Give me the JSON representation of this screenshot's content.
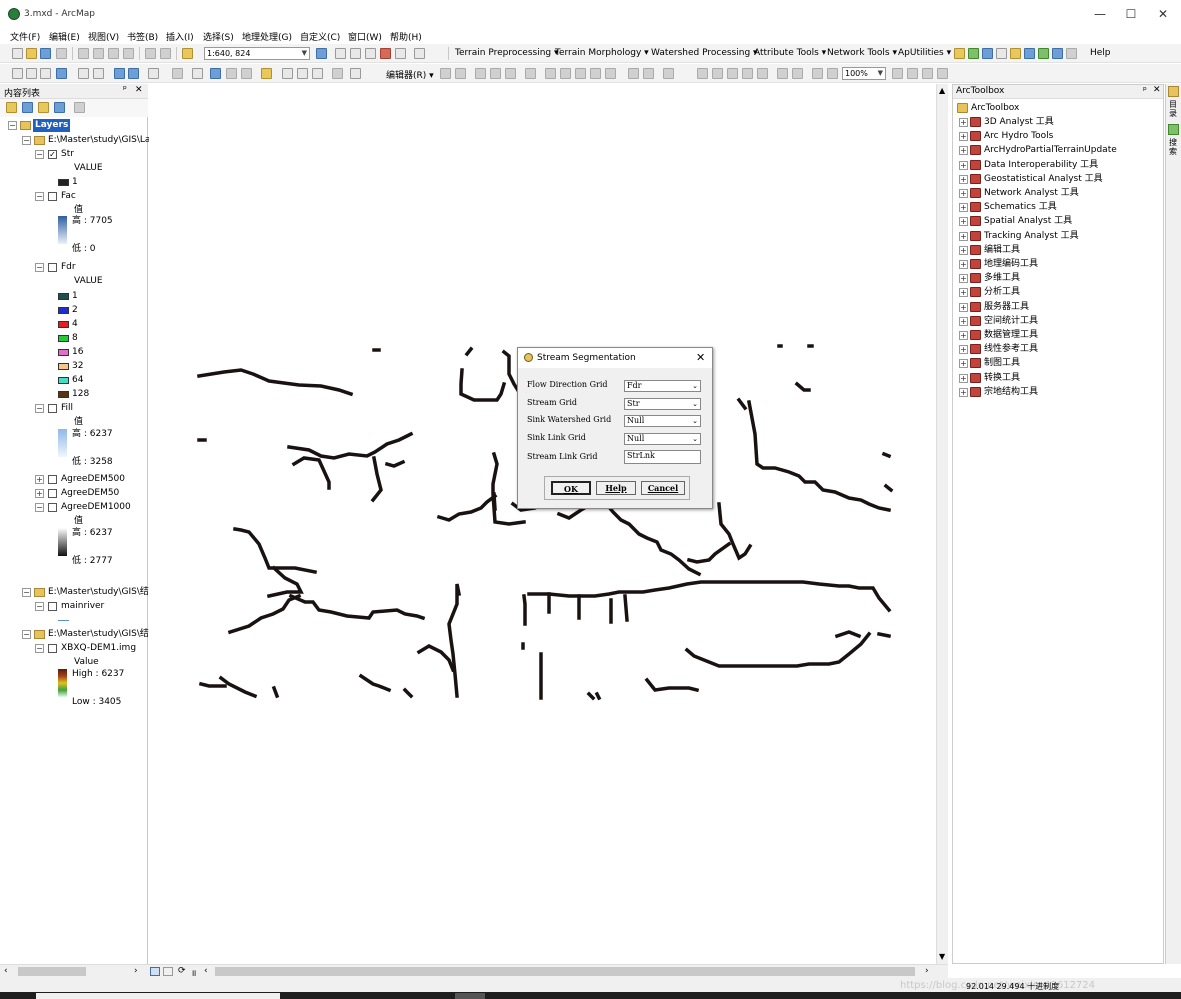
{
  "window": {
    "title": "3.mxd - ArcMap",
    "minimize": "—",
    "maximize": "☐",
    "close": "✕"
  },
  "menu": [
    "文件(F)",
    "编辑(E)",
    "视图(V)",
    "书签(B)",
    "插入(I)",
    "选择(S)",
    "地理处理(G)",
    "自定义(C)",
    "窗口(W)",
    "帮助(H)"
  ],
  "toolbar1": {
    "scale": "1:640, 824",
    "terrain_preprocessing": "Terrain Preprocessing ▾",
    "terrain_morphology": "Terrain Morphology ▾",
    "watershed_processing": "Watershed Processing ▾",
    "attribute_tools": "Attribute Tools ▾",
    "network_tools": "Network Tools ▾",
    "aputilities": "ApUtilities ▾",
    "help": "Help"
  },
  "toolbar2": {
    "editor": "编辑器(R) ▾",
    "zoom": "100%"
  },
  "toc": {
    "title": "内容列表",
    "pin": "ᵖ",
    "close": "✕",
    "layers_label": "Layers",
    "group1_label": "E:\\Master\\study\\GIS\\La",
    "group2_label": "E:\\Master\\study\\GIS\\结",
    "group3_label": "E:\\Master\\study\\GIS\\结",
    "str": {
      "name": "Str",
      "field": "VALUE",
      "value": "1"
    },
    "fac": {
      "name": "Fac",
      "field": "值",
      "high": "高 : 7705",
      "low": "低 : 0"
    },
    "fdr": {
      "name": "Fdr",
      "field": "VALUE",
      "classes": [
        {
          "label": "1",
          "color": "#1f4e4e"
        },
        {
          "label": "2",
          "color": "#1b2fd1"
        },
        {
          "label": "4",
          "color": "#e51f1f"
        },
        {
          "label": "8",
          "color": "#24c93a"
        },
        {
          "label": "16",
          "color": "#e76cc9"
        },
        {
          "label": "32",
          "color": "#f2c98a"
        },
        {
          "label": "64",
          "color": "#3fe0c3"
        },
        {
          "label": "128",
          "color": "#5a3512"
        }
      ]
    },
    "fill": {
      "name": "Fill",
      "field": "值",
      "high": "高 : 6237",
      "low": "低 : 3258"
    },
    "agreedem500": "AgreeDEM500",
    "agreedem50": "AgreeDEM50",
    "agreedem1000": {
      "name": "AgreeDEM1000",
      "field": "值",
      "high": "高 : 6237",
      "low": "低 : 2777"
    },
    "mainriver": "mainriver",
    "xbxq": {
      "name": "XBXQ-DEM1.img",
      "field": "Value",
      "high": "High : 6237",
      "low": "Low : 3405"
    }
  },
  "arctoolbox": {
    "title": "ArcToolbox",
    "root": "ArcToolbox",
    "items": [
      "3D Analyst 工具",
      "Arc Hydro Tools",
      "ArcHydroPartialTerrainUpdate",
      "Data Interoperability 工具",
      "Geostatistical Analyst 工具",
      "Network Analyst 工具",
      "Schematics 工具",
      "Spatial Analyst 工具",
      "Tracking Analyst 工具",
      "编辑工具",
      "地理编码工具",
      "多维工具",
      "分析工具",
      "服务器工具",
      "空间统计工具",
      "数据管理工具",
      "线性参考工具",
      "制图工具",
      "转换工具",
      "宗地结构工具"
    ]
  },
  "dialog": {
    "title": "Stream Segmentation",
    "close": "✕",
    "fields": [
      {
        "label": "Flow Direction Grid",
        "value": "Fdr"
      },
      {
        "label": "Stream Grid",
        "value": "Str"
      },
      {
        "label": "Sink Watershed Grid",
        "value": "Null"
      },
      {
        "label": "Sink Link Grid",
        "value": "Null"
      }
    ],
    "output_label": "Stream Link Grid",
    "output_value": "StrLnk",
    "ok": "OK",
    "help": "Help",
    "cancel": "Cancel"
  },
  "status": {
    "coords": "92.014  29.494 十进制度",
    "watermark": "https://blog.csdn.net/weixin_43612724"
  },
  "side_strip": {
    "tab1": "目录",
    "tab2": "搜索"
  }
}
